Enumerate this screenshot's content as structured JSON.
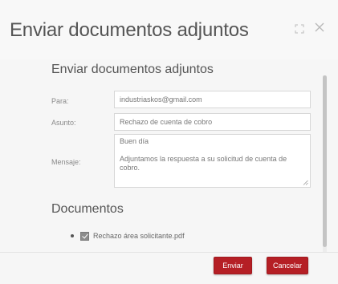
{
  "dialog": {
    "title": "Enviar documentos adjuntos",
    "icons": {
      "expand": "expand-icon",
      "close": "close-icon"
    }
  },
  "form": {
    "section_title": "Enviar documentos adjuntos",
    "to": {
      "label": "Para:",
      "value": "industriaskos@gmail.com"
    },
    "subject": {
      "label": "Asunto:",
      "value": "Rechazo de cuenta de cobro"
    },
    "message": {
      "label": "Mensaje:",
      "lines": [
        "Buen día",
        "",
        "Adjuntamos la respuesta a su solicitud de cuenta de cobro."
      ]
    }
  },
  "documents": {
    "title": "Documentos",
    "items": [
      {
        "name": "Rechazo área solicitante.pdf",
        "checked": true
      }
    ]
  },
  "footer": {
    "send_label": "Enviar",
    "cancel_label": "Cancelar"
  },
  "colors": {
    "accent": "#b51f25",
    "background": "#f6f6f6",
    "text": "#555555"
  }
}
